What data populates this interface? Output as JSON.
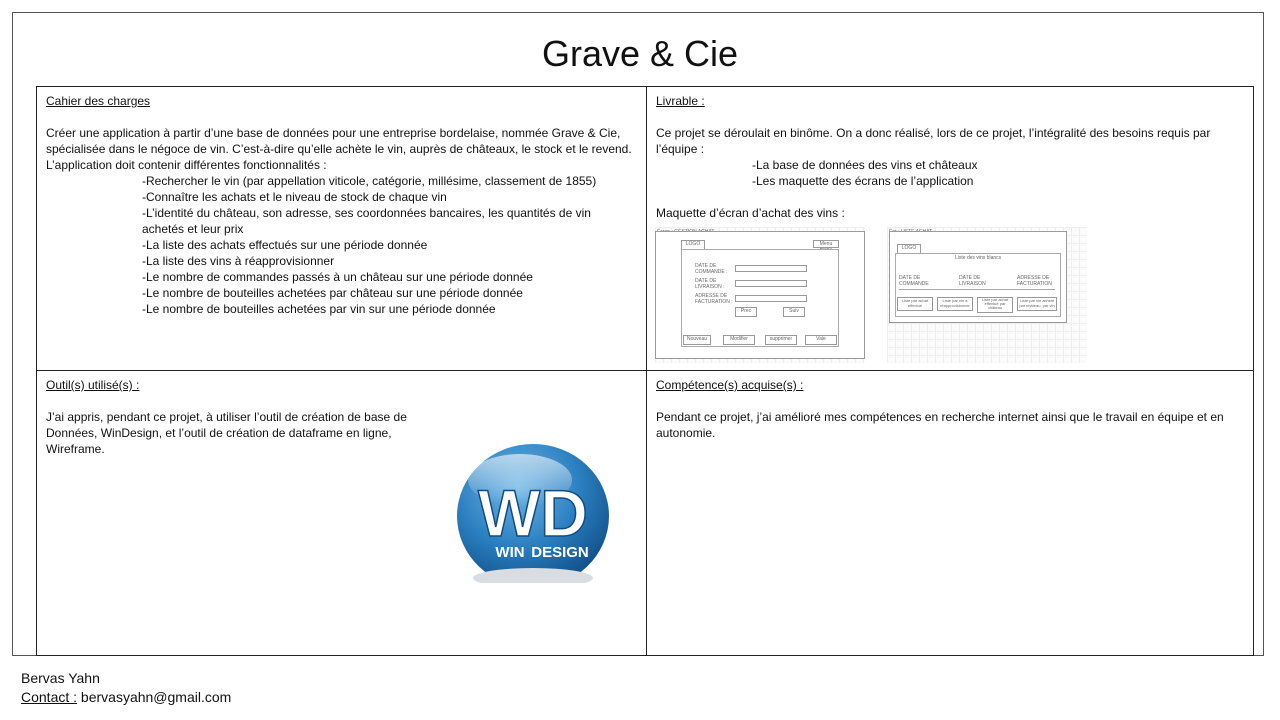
{
  "title": "Grave & Cie",
  "cahier": {
    "heading": "Cahier des charges",
    "intro_1": "Créer une application à partir d’une base de données pour une entreprise bordelaise, nommée Grave & Cie,",
    "intro_2": "spécialisée dans le négoce de vin. C’est-à-dire qu’elle achète le vin, auprès de châteaux, le stock et le revend.",
    "intro_3": "L’application doit contenir différentes fonctionnalités :",
    "items": [
      "-Rechercher le vin (par appellation viticole, catégorie, millésime, classement de 1855)",
      "-Connaître les achats et le niveau de stock de chaque vin",
      "-L’identité du château, son adresse, ses coordonnées bancaires, les quantités de vin",
      "achetés et leur prix",
      "-La liste des achats effectués sur une période donnée",
      "-La liste des vins à réapprovisionner",
      "-Le nombre de commandes passés à un château sur une période donnée",
      "-Le nombre de bouteilles achetées par château sur une période donnée",
      "-Le nombre de bouteilles achetées par vin sur une période donnée"
    ]
  },
  "livrable": {
    "heading": "Livrable :",
    "intro_1": "Ce projet se déroulait en binôme. On a donc réalisé, lors de ce projet, l’intégralité des besoins requis par",
    "intro_2": "l’équipe :",
    "items": [
      "-La base de données des vins et châteaux",
      "-Les maquette des écrans de l’application"
    ],
    "maquette_label": "Maquette d’écran d’achat des vins :",
    "mock1": {
      "title": "Écran : GESTION ACHAT",
      "logo": "LOGO",
      "top_button": "Menu menu",
      "field_1a": "DATE DE",
      "field_1b": "COMMANDE :",
      "field_2a": "DATE DE",
      "field_2b": "LIVRAISON :",
      "field_3a": "ADRESSE DE",
      "field_3b": "FACTURATION :",
      "prev": "Prec",
      "next": "Suiv",
      "buttons": [
        "Nouveau",
        "Modifier",
        "supprimer",
        "Vale"
      ]
    },
    "mock2": {
      "title": "Écr : LISTE ACHAT",
      "logo": "LOGO",
      "list_title": "Liste des vins blancs",
      "col_1a": "DATE DE",
      "col_1b": "COMMANDE",
      "col_2a": "DATE DE",
      "col_2b": "LIVRAISON",
      "col_3a": "ADRESSE DE",
      "col_3b": "FACTURATION",
      "buttons": [
        "Liste par achat effectué",
        "Liste par vin à réapprovisionner",
        "Liste par achat effectué par château",
        "Liste par vin acheté par château, par vin"
      ]
    }
  },
  "outils": {
    "heading": "Outil(s) utilisé(s) :",
    "line_1": "J’ai appris, pendant ce projet, à utiliser l’outil de création de base de",
    "line_2": "Données, WinDesign, et l’outil de création de dataframe en ligne,",
    "line_3": "Wireframe.",
    "logo_letters": "WD",
    "logo_word_a": "WIN",
    "logo_word_b": "DESIGN"
  },
  "competences": {
    "heading": "Compétence(s) acquise(s) :",
    "line_1": "Pendant ce projet, j’ai amélioré mes compétences en recherche internet ainsi que le travail en équipe et en",
    "line_2": "autonomie."
  },
  "footer": {
    "name": "Bervas Yahn",
    "contact_label": "Contact :",
    "email": " bervasyahn@gmail.com"
  }
}
